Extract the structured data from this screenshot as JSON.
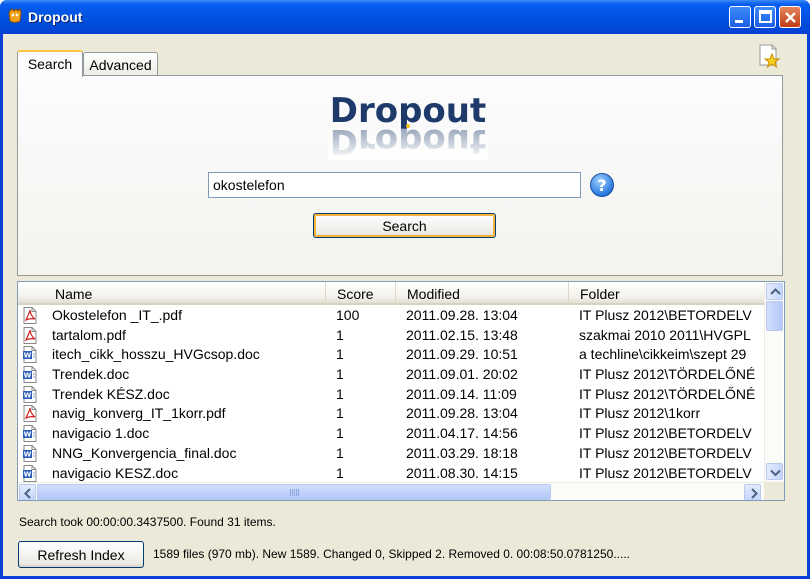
{
  "window": {
    "title": "Dropout"
  },
  "tabs": [
    {
      "label": "Search",
      "active": true
    },
    {
      "label": "Advanced",
      "active": false
    }
  ],
  "logo": {
    "text": "Dropout"
  },
  "search": {
    "query": "okostelefon",
    "button_label": "Search"
  },
  "results": {
    "columns": {
      "name": "Name",
      "score": "Score",
      "modified": "Modified",
      "folder": "Folder"
    },
    "rows": [
      {
        "icon": "pdf-icon",
        "name": "Okostelefon _IT_.pdf",
        "score": "100",
        "modified": "2011.09.28. 13:04",
        "folder": "IT Plusz 2012\\BETORDELV"
      },
      {
        "icon": "pdf-icon",
        "name": "tartalom.pdf",
        "score": "1",
        "modified": "2011.02.15. 13:48",
        "folder": "szakmai 2010 2011\\HVGPL"
      },
      {
        "icon": "doc-icon",
        "name": "itech_cikk_hosszu_HVGcsop.doc",
        "score": "1",
        "modified": "2011.09.29. 10:51",
        "folder": "a techline\\cikkeim\\szept 29"
      },
      {
        "icon": "doc-icon",
        "name": "Trendek.doc",
        "score": "1",
        "modified": "2011.09.01. 20:02",
        "folder": "IT Plusz 2012\\TÖRDELŐNÉ"
      },
      {
        "icon": "doc-icon",
        "name": "Trendek KÉSZ.doc",
        "score": "1",
        "modified": "2011.09.14. 11:09",
        "folder": "IT Plusz 2012\\TÖRDELŐNÉ"
      },
      {
        "icon": "pdf-icon",
        "name": "navig_konverg_IT_1korr.pdf",
        "score": "1",
        "modified": "2011.09.28. 13:04",
        "folder": "IT Plusz 2012\\1korr"
      },
      {
        "icon": "doc-icon",
        "name": "navigacio 1.doc",
        "score": "1",
        "modified": "2011.04.17. 14:56",
        "folder": "IT Plusz 2012\\BETORDELV"
      },
      {
        "icon": "doc-icon",
        "name": "NNG_Konvergencia_final.doc",
        "score": "1",
        "modified": "2011.03.29. 18:18",
        "folder": "IT Plusz 2012\\BETORDELV"
      },
      {
        "icon": "doc-icon",
        "name": "navigacio KESZ.doc",
        "score": "1",
        "modified": "2011.08.30. 14:15",
        "folder": "IT Plusz 2012\\BETORDELV"
      }
    ]
  },
  "status": {
    "search_summary": "Search took 00:00:00.3437500. Found 31 items.",
    "refresh_label": "Refresh Index",
    "index_summary": "1589 files (970 mb). New 1589. Changed 0, Skipped 2. Removed 0. 00:08:50.0781250....."
  }
}
